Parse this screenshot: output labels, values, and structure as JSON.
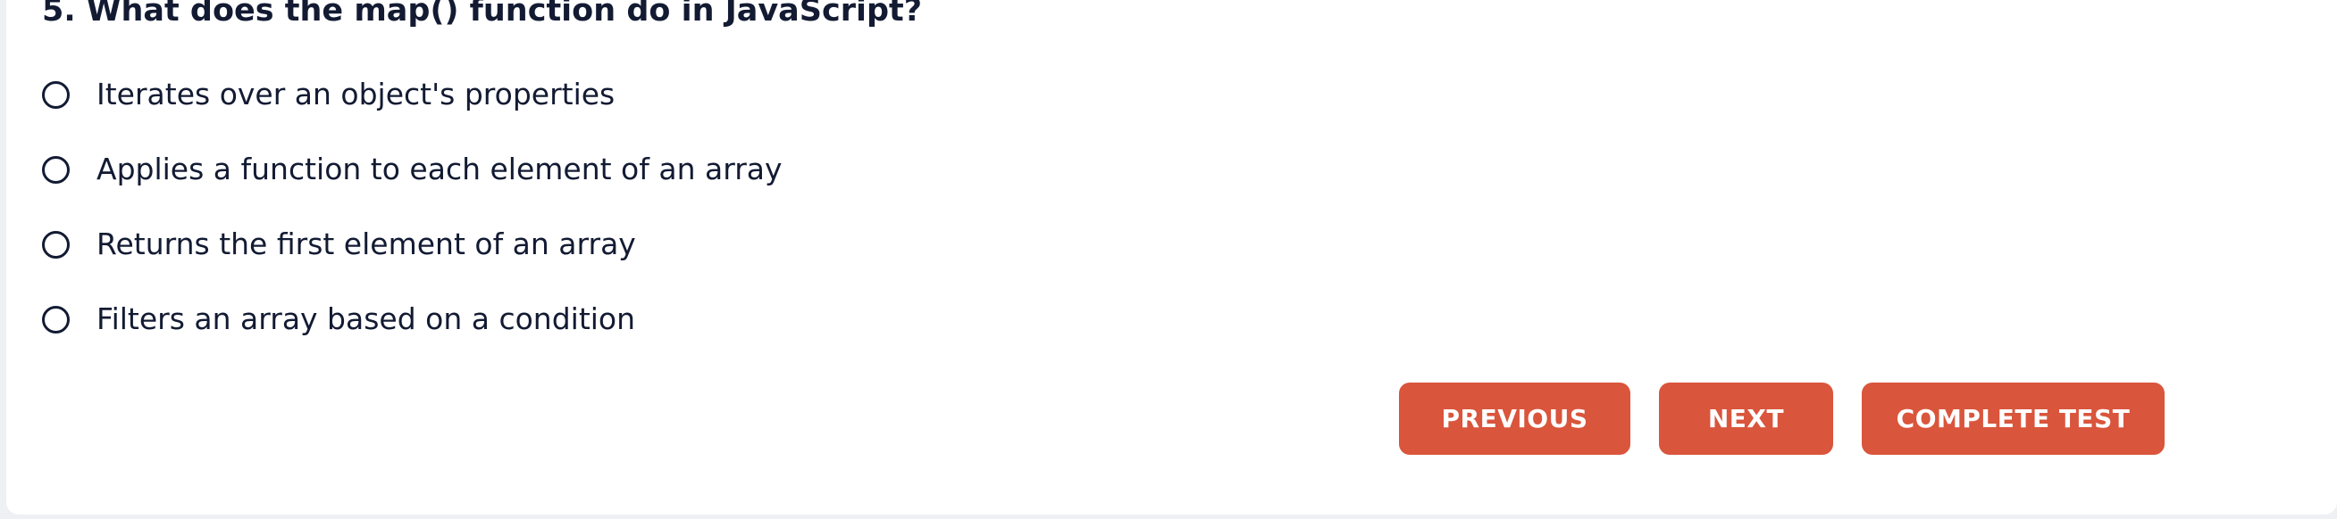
{
  "question": {
    "text": "5. What does the map() function do in JavaScript?"
  },
  "options": [
    {
      "label": "Iterates over an object's properties",
      "selected": false
    },
    {
      "label": "Applies a function to each element of an array",
      "selected": false
    },
    {
      "label": "Returns the first element of an array",
      "selected": false
    },
    {
      "label": "Filters an array based on a condition",
      "selected": false
    }
  ],
  "buttons": {
    "previous": "PREVIOUS",
    "next": "NEXT",
    "complete": "COMPLETE TEST"
  },
  "colors": {
    "accent": "#d9553c",
    "text": "#131b33",
    "card": "#ffffff",
    "background": "#eef0f3"
  }
}
